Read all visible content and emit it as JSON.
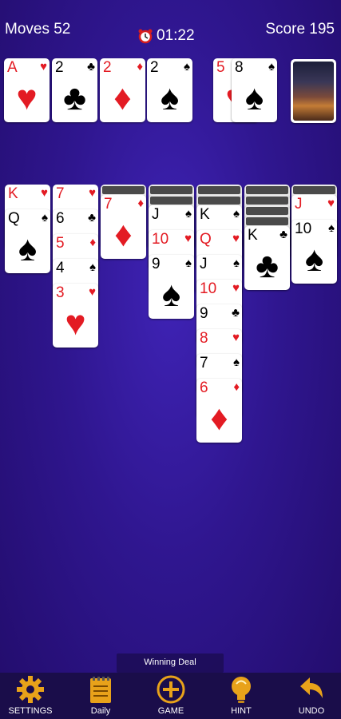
{
  "header": {
    "moves_label": "Moves 52",
    "timer": "01:22",
    "score_label": "Score 195"
  },
  "foundations": [
    {
      "rank": "A",
      "suit": "♥",
      "color": "red"
    },
    {
      "rank": "2",
      "suit": "♣",
      "color": "blk"
    },
    {
      "rank": "2",
      "suit": "♦",
      "color": "red"
    },
    {
      "rank": "2",
      "suit": "♠",
      "color": "blk"
    }
  ],
  "waste": [
    {
      "rank": "5",
      "suit": "♥",
      "color": "red"
    },
    {
      "rank": "8",
      "suit": "♠",
      "color": "blk"
    }
  ],
  "tableau": [
    {
      "facedown": 0,
      "cards": [
        {
          "rank": "K",
          "suit": "♥",
          "color": "red"
        },
        {
          "rank": "Q",
          "suit": "♠",
          "color": "blk"
        }
      ]
    },
    {
      "facedown": 0,
      "cards": [
        {
          "rank": "7",
          "suit": "♥",
          "color": "red"
        },
        {
          "rank": "6",
          "suit": "♣",
          "color": "blk"
        },
        {
          "rank": "5",
          "suit": "♦",
          "color": "red"
        },
        {
          "rank": "4",
          "suit": "♠",
          "color": "blk"
        },
        {
          "rank": "3",
          "suit": "♥",
          "color": "red"
        }
      ]
    },
    {
      "facedown": 1,
      "cards": [
        {
          "rank": "7",
          "suit": "♦",
          "color": "red"
        }
      ]
    },
    {
      "facedown": 2,
      "cards": [
        {
          "rank": "J",
          "suit": "♠",
          "color": "blk"
        },
        {
          "rank": "10",
          "suit": "♥",
          "color": "red"
        },
        {
          "rank": "9",
          "suit": "♠",
          "color": "blk"
        }
      ]
    },
    {
      "facedown": 2,
      "cards": [
        {
          "rank": "K",
          "suit": "♠",
          "color": "blk"
        },
        {
          "rank": "Q",
          "suit": "♥",
          "color": "red"
        },
        {
          "rank": "J",
          "suit": "♠",
          "color": "blk"
        },
        {
          "rank": "10",
          "suit": "♥",
          "color": "red"
        },
        {
          "rank": "9",
          "suit": "♣",
          "color": "blk"
        },
        {
          "rank": "8",
          "suit": "♥",
          "color": "red"
        },
        {
          "rank": "7",
          "suit": "♠",
          "color": "blk"
        },
        {
          "rank": "6",
          "suit": "♦",
          "color": "red"
        }
      ]
    },
    {
      "facedown": 4,
      "cards": [
        {
          "rank": "K",
          "suit": "♣",
          "color": "blk"
        }
      ]
    },
    {
      "facedown": 1,
      "cards": [
        {
          "rank": "J",
          "suit": "♥",
          "color": "red"
        },
        {
          "rank": "10",
          "suit": "♠",
          "color": "blk"
        }
      ]
    }
  ],
  "winning_deal_label": "Winning Deal",
  "toolbar": {
    "settings": "SETTINGS",
    "daily": "Daily",
    "game": "GAME",
    "hint": "HINT",
    "undo": "UNDO"
  },
  "colors": {
    "red": "#e31b23",
    "black": "#000000",
    "icon_gold": "#e8a21a",
    "bar": "#1a0d4a"
  }
}
